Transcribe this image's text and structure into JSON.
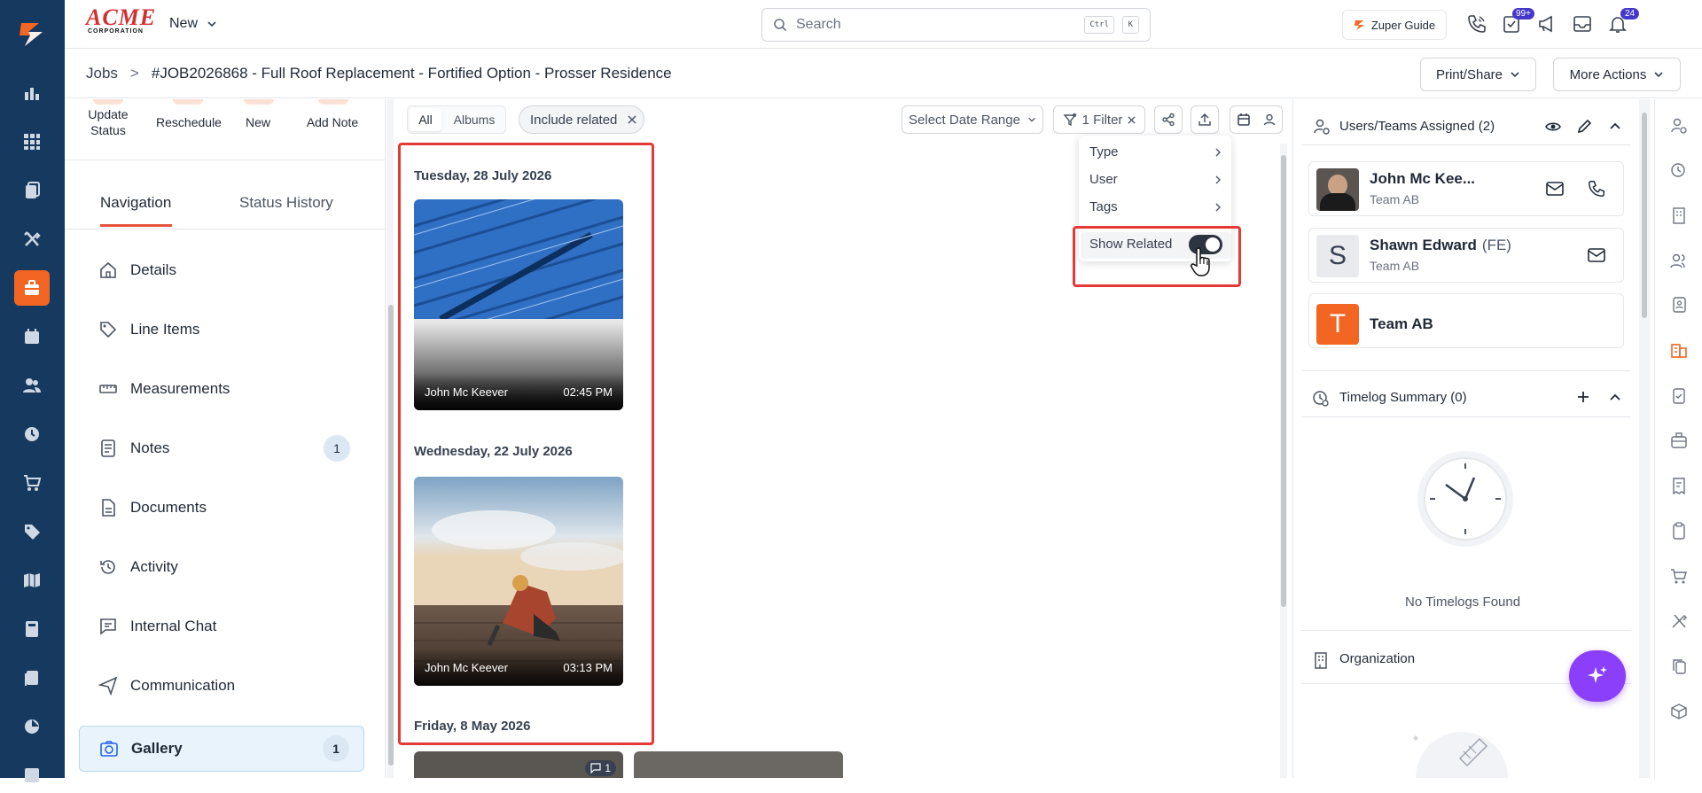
{
  "brand": {
    "logo_text": "ACME",
    "logo_sub": "CORPORATION",
    "new_label": "New"
  },
  "search": {
    "placeholder": "Search",
    "kbd1": "Ctrl",
    "kbd2": "K"
  },
  "topbar": {
    "guide_label": "Zuper Guide",
    "tasks_badge": "99+",
    "notif_badge": "24"
  },
  "breadcrumb": {
    "root": "Jobs",
    "sep": ">",
    "current": "#JOB2026868 - Full Roof Replacement - Fortified Option - Prosser Residence"
  },
  "header_actions": {
    "print_share": "Print/Share",
    "more_actions": "More Actions"
  },
  "quick_actions": [
    {
      "label_1": "Update",
      "label_2": "Status"
    },
    {
      "label": "Reschedule"
    },
    {
      "label": "New"
    },
    {
      "label": "Add Note"
    }
  ],
  "tabs": {
    "navigation": "Navigation",
    "status_history": "Status History"
  },
  "nav": [
    {
      "label": "Details",
      "icon": "home-icon"
    },
    {
      "label": "Line Items",
      "icon": "tag-icon"
    },
    {
      "label": "Measurements",
      "icon": "ruler-icon"
    },
    {
      "label": "Notes",
      "icon": "note-icon",
      "badge": "1"
    },
    {
      "label": "Documents",
      "icon": "document-icon"
    },
    {
      "label": "Activity",
      "icon": "history-icon"
    },
    {
      "label": "Internal Chat",
      "icon": "chat-icon"
    },
    {
      "label": "Communication",
      "icon": "send-icon"
    },
    {
      "label": "Gallery",
      "icon": "camera-icon",
      "badge": "1"
    }
  ],
  "gallery_toolbar": {
    "tab_all": "All",
    "tab_albums": "Albums",
    "chip_related": "Include related",
    "date_range": "Select Date Range",
    "filter_label": "1 Filter"
  },
  "filter_menu": {
    "type": "Type",
    "user": "User",
    "tags": "Tags",
    "show_related": "Show Related",
    "show_related_on": true
  },
  "gallery": [
    {
      "date": "Tuesday, 28 July 2026",
      "author": "John Mc Keever",
      "time": "02:45 PM"
    },
    {
      "date": "Wednesday, 22 July 2026",
      "author": "John Mc Keever",
      "time": "03:13 PM"
    },
    {
      "date": "Friday, 8 May 2026",
      "comment_count": "1"
    }
  ],
  "assigned": {
    "title": "Users/Teams Assigned (2)",
    "users": [
      {
        "name": "John Mc Kee...",
        "team": "Team AB"
      },
      {
        "initial": "S",
        "name": "Shawn Edward",
        "role": "(FE)",
        "team": "Team AB"
      },
      {
        "initial": "T",
        "name": "Team AB"
      }
    ]
  },
  "timelog": {
    "title": "Timelog Summary (0)",
    "empty": "No Timelogs Found"
  },
  "organization": {
    "title": "Organization"
  },
  "colors": {
    "rail": "#163a5f",
    "accent": "#f26522",
    "highlight": "#e53935",
    "fab": "#7c3aed"
  }
}
